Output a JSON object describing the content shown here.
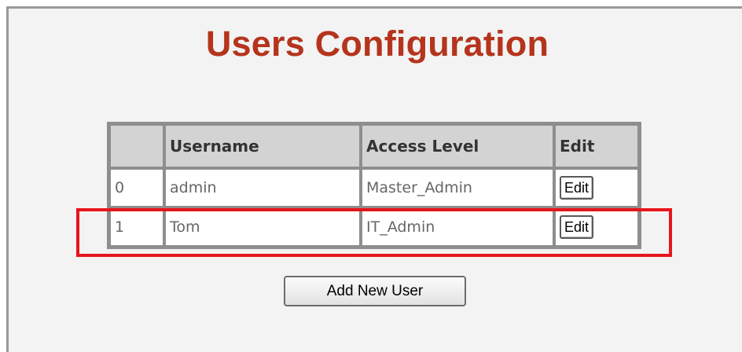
{
  "page": {
    "title": "Users Configuration"
  },
  "table": {
    "headers": [
      "",
      "Username",
      "Access Level",
      "Edit"
    ],
    "rows": [
      {
        "index": "0",
        "username": "admin",
        "access_level": "Master_Admin",
        "edit_label": "Edit"
      },
      {
        "index": "1",
        "username": "Tom",
        "access_level": "IT_Admin",
        "edit_label": "Edit"
      }
    ]
  },
  "actions": {
    "add_user_label": "Add New User"
  },
  "colors": {
    "title": "#b5341c",
    "highlight": "#e8151b",
    "panel_background": "#f3f3f3",
    "header_background": "#d3d3d3"
  }
}
